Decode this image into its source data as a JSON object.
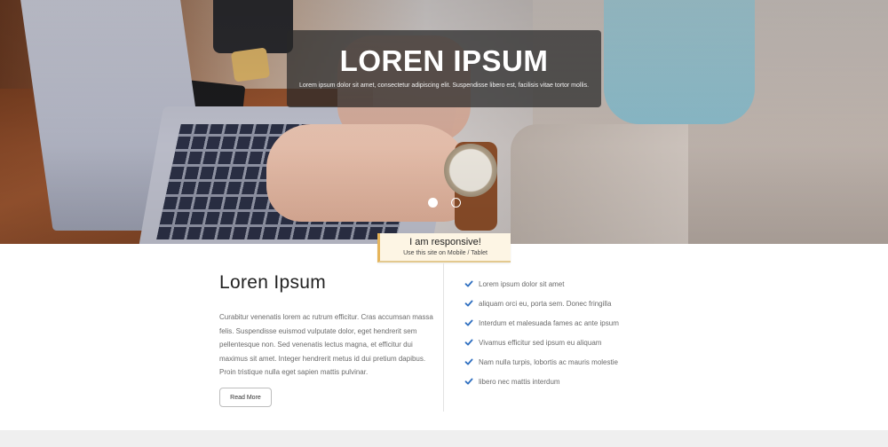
{
  "hero": {
    "title": "LOREN IPSUM",
    "subtitle": "Lorem ipsum dolor sit amet, consectetur adipiscing elit. Suspendisse libero est, facilisis vitae tortor mollis.",
    "slides": 2,
    "active_slide": 1
  },
  "responsive_badge": {
    "title": "I am responsive!",
    "subtitle": "Use this site on Mobile / Tablet"
  },
  "about": {
    "heading": "Loren Ipsum",
    "body": "Curabitur venenatis lorem ac rutrum efficitur. Cras accumsan massa felis. Suspendisse euismod vulputate dolor, eget hendrerit sem pellentesque non. Sed venenatis lectus magna, et efficitur dui maximus sit amet. Integer hendrerit metus id dui pretium dapibus. Proin tristique nulla eget sapien mattis pulvinar.",
    "button_label": "Read More"
  },
  "features": [
    "Lorem ipsum dolor sit amet",
    "aliquam orci eu, porta sem. Donec fringilla",
    "Interdum et malesuada fames ac ante ipsum",
    "Vivamus efficitur sed ipsum eu aliquam",
    "Nam nulla turpis, lobortis ac mauris molestie",
    "libero nec mattis interdum"
  ],
  "colors": {
    "check": "#2f6fc0",
    "badge_accent": "#e6b55b",
    "footer_band": "#efefef"
  }
}
